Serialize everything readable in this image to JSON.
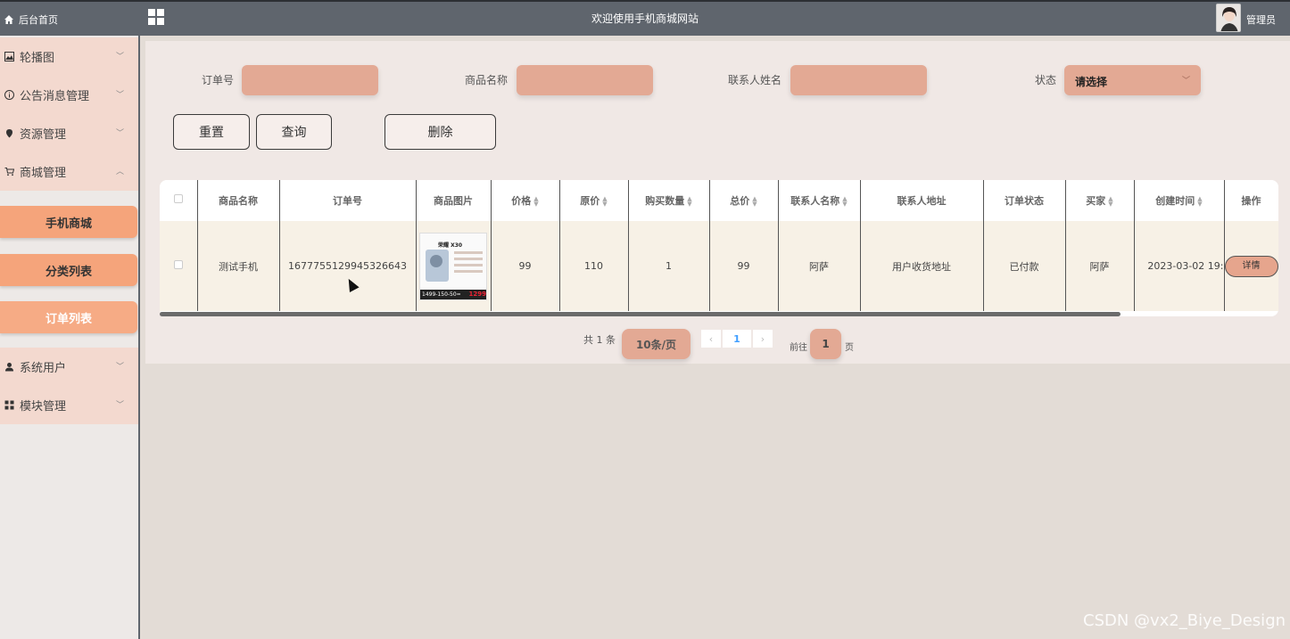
{
  "header": {
    "home_label": "后台首页",
    "site_title": "欢迎使用手机商城网站",
    "user_name": "管理员"
  },
  "sidebar": {
    "items": [
      {
        "label": "轮播图",
        "icon": "image-icon"
      },
      {
        "label": "公告消息管理",
        "icon": "info-circle-icon"
      },
      {
        "label": "资源管理",
        "icon": "location-pin-icon"
      },
      {
        "label": "商城管理",
        "icon": "shopping-cart-icon"
      },
      {
        "label": "系统用户",
        "icon": "user-icon"
      },
      {
        "label": "模块管理",
        "icon": "grid-icon"
      }
    ],
    "sub_items": [
      {
        "label": "手机商城"
      },
      {
        "label": "分类列表"
      },
      {
        "label": "订单列表"
      }
    ]
  },
  "filters": {
    "order_no_label": "订单号",
    "product_name_label": "商品名称",
    "contact_name_label": "联系人姓名",
    "status_label": "状态",
    "status_value": "请选择"
  },
  "actions": {
    "reset": "重置",
    "search": "查询",
    "delete": "删除"
  },
  "table": {
    "columns": [
      "商品名称",
      "订单号",
      "商品图片",
      "价格",
      "原价",
      "购买数量",
      "总价",
      "联系人名称",
      "联系人地址",
      "订单状态",
      "买家",
      "创建时间",
      "操作"
    ],
    "rows": [
      {
        "product_name": "测试手机",
        "order_no": "1677755129945326643",
        "image_brand": "荣耀 X30",
        "image_price_band": "1499-150-50=",
        "image_price": "1299",
        "price": "99",
        "original_price": "110",
        "quantity": "1",
        "total": "99",
        "contact_name": "阿萨",
        "contact_address": "用户收货地址",
        "status": "已付款",
        "buyer": "阿萨",
        "created_at": "2023-03-02 19:",
        "detail_label": "详情"
      }
    ]
  },
  "pagination": {
    "total": "共 1 条",
    "page_size": "10条/页",
    "prev": "‹",
    "current": "1",
    "next": "›",
    "goto": "前往",
    "goto_value": "1",
    "page_unit": "页"
  },
  "watermark": "CSDN @vx2_Biye_Design",
  "colors": {
    "topbar": "#5f656d",
    "accent": "#e3a994",
    "submenu": "#f5a47b",
    "page_link": "#409eff"
  }
}
